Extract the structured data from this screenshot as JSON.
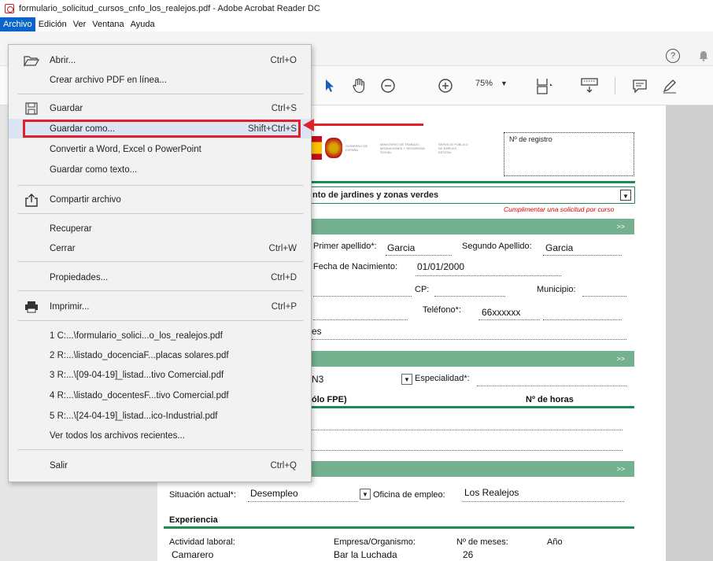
{
  "window": {
    "title": "formulario_solicitud_cursos_cnfo_los_realejos.pdf - Adobe Acrobat Reader DC"
  },
  "menubar": [
    "Archivo",
    "Edición",
    "Ver",
    "Ventana",
    "Ayuda"
  ],
  "toolbar": {
    "zoom": "75%",
    "help": "?"
  },
  "file_menu": {
    "open": {
      "label": "Abrir...",
      "shortcut": "Ctrl+O"
    },
    "create_pdf": {
      "label": "Crear archivo PDF en línea..."
    },
    "save": {
      "label": "Guardar",
      "shortcut": "Ctrl+S"
    },
    "save_as": {
      "label": "Guardar como...",
      "shortcut": "Shift+Ctrl+S"
    },
    "convert": {
      "label": "Convertir a Word, Excel o PowerPoint"
    },
    "save_text": {
      "label": "Guardar como texto..."
    },
    "share": {
      "label": "Compartir archivo"
    },
    "recover": {
      "label": "Recuperar"
    },
    "close": {
      "label": "Cerrar",
      "shortcut": "Ctrl+W"
    },
    "properties": {
      "label": "Propiedades...",
      "shortcut": "Ctrl+D"
    },
    "print": {
      "label": "Imprimir...",
      "shortcut": "Ctrl+P"
    },
    "recent": [
      "1 C:...\\formulario_solici...o_los_realejos.pdf",
      "2 R:...\\listado_docenciaF...placas solares.pdf",
      "3 R:...\\[09-04-19]_listad...tivo Comercial.pdf",
      "4 R:...\\listado_docentesF...tivo Comercial.pdf",
      "5 R:...\\[24-04-19]_listad...ico-Industrial.pdf"
    ],
    "view_all_recent": {
      "label": "Ver todos los archivos recientes..."
    },
    "exit": {
      "label": "Salir",
      "shortcut": "Ctrl+Q"
    }
  },
  "document": {
    "logo_lines": [
      "GOBIERNO DE ESPAÑA",
      "MINISTERIO DE TRABAJO, MIGRACIONES Y SEGURIDAD SOCIAL",
      "SERVICIO PÚBLICO DE EMPLEO ESTATAL"
    ],
    "registro_label": "Nº de registro",
    "course_value": "nto de jardines y zonas verdes",
    "cumplimentar": "Cumplimentar una solicitud por curso",
    "bar_arrows": ">>",
    "primer_apellido_label": "Primer apellido*:",
    "primer_apellido": "Garcia",
    "segundo_apellido_label": "Segundo Apellido:",
    "segundo_apellido": "Garcia",
    "fecha_label": "Fecha de Nacimiento:",
    "fecha": "01/01/2000",
    "cp_label": "CP:",
    "municipio_label": "Municipio:",
    "telefono_label": "Teléfono*:",
    "telefono": "66xxxxxx",
    "es_fragment": "es",
    "nivel_fragment": "N3",
    "especialidad_label": "Especialidad*:",
    "solo_fpe": "ólo FPE)",
    "horas_label": "Nº de horas",
    "situacion_label": "Situación actual*:",
    "situacion": "Desempleo",
    "oficina_label": "Oficina de empleo:",
    "oficina": "Los Realejos",
    "experiencia_label": "Experiencia",
    "actividad_label": "Actividad laboral:",
    "empresa_label": "Empresa/Organismo:",
    "meses_label": "Nº de meses:",
    "anio_label": "Año",
    "actividad": "Camarero",
    "empresa": "Bar la Luchada",
    "meses": "26"
  }
}
